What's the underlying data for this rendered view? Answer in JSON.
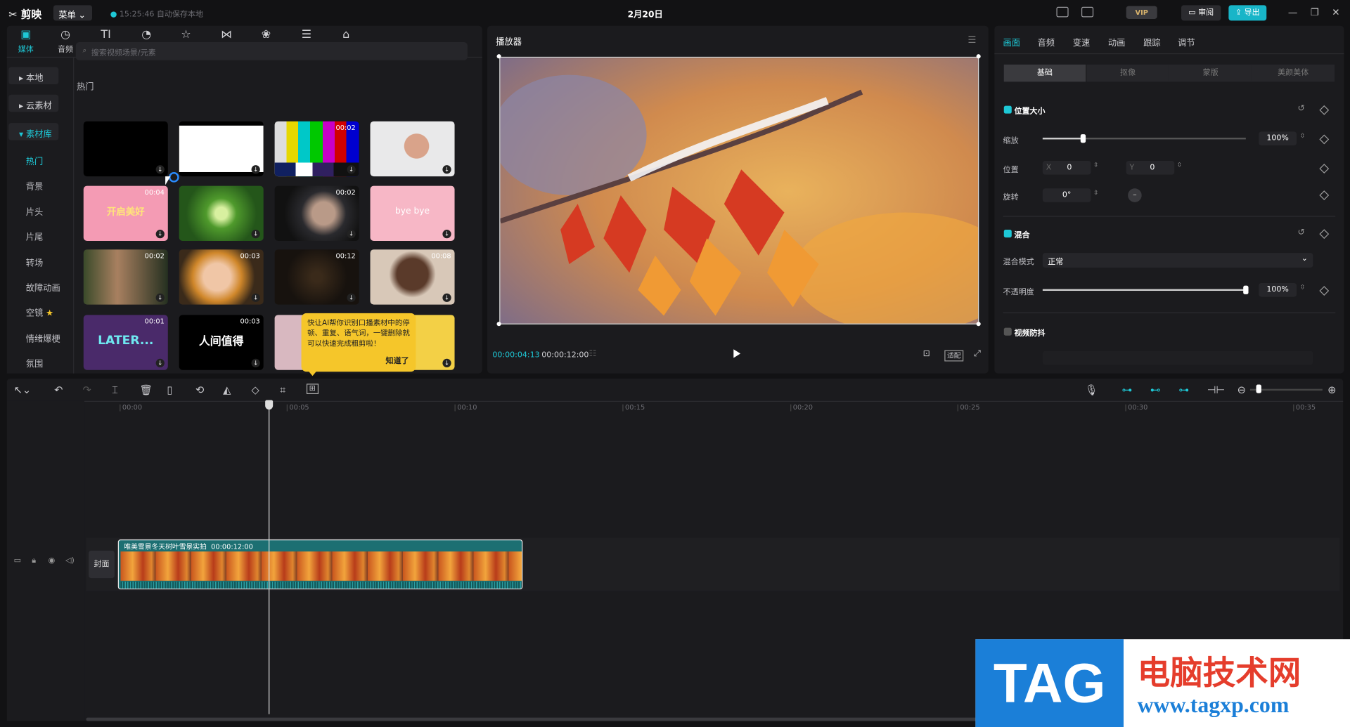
{
  "titlebar": {
    "app_name": "剪映",
    "menu_label": "菜单",
    "save_status": "15:25:46 自动保存本地",
    "project_date": "2月20日",
    "vip_label": "VIP",
    "review_label": "审阅",
    "export_label": "导出"
  },
  "media": {
    "tabs": [
      {
        "label": "媒体",
        "icon": "media-icon"
      },
      {
        "label": "音频",
        "icon": "audio-icon"
      },
      {
        "label": "文本",
        "icon": "text-icon"
      },
      {
        "label": "贴纸",
        "icon": "sticker-icon"
      },
      {
        "label": "特效",
        "icon": "effects-icon"
      },
      {
        "label": "转场",
        "icon": "transition-icon"
      },
      {
        "label": "滤镜",
        "icon": "filter-icon"
      },
      {
        "label": "调节",
        "icon": "adjust-icon"
      },
      {
        "label": "模板",
        "icon": "template-icon"
      }
    ],
    "sidebar": [
      "本地",
      "云素材",
      "素材库"
    ],
    "subsidebar": [
      "热门",
      "背景",
      "片头",
      "片尾",
      "转场",
      "故障动画",
      "空镜",
      "情绪爆梗",
      "氛围"
    ],
    "search_placeholder": "搜索视频场景/元素",
    "section_title": "热门",
    "thumbs": [
      {
        "duration": ""
      },
      {
        "duration": ""
      },
      {
        "duration": "00:02"
      },
      {
        "duration": ""
      },
      {
        "duration": "00:04",
        "text": "开启美好"
      },
      {
        "duration": ""
      },
      {
        "duration": "00:02"
      },
      {
        "duration": "",
        "text": "bye bye"
      },
      {
        "duration": "00:02"
      },
      {
        "duration": "00:03"
      },
      {
        "duration": "00:12"
      },
      {
        "duration": "00:08"
      },
      {
        "duration": "00:01",
        "text": "LATER..."
      },
      {
        "duration": "00:03",
        "text": "人间值得"
      },
      {
        "duration": ""
      },
      {
        "duration": ""
      }
    ],
    "tooltip_text": "快让AI帮你识别口播素材中的停顿、重复、语气词，一键删除就可以快速完成粗剪啦！",
    "tooltip_action": "知道了"
  },
  "player": {
    "title": "播放器",
    "current_time": "00:00:04:13",
    "total_time": "00:00:12:00",
    "ratio_label": "适配"
  },
  "properties": {
    "tabs": [
      "画面",
      "音频",
      "变速",
      "动画",
      "跟踪",
      "调节"
    ],
    "subtabs": [
      "基础",
      "抠像",
      "蒙版",
      "美颜美体"
    ],
    "position_size_title": "位置大小",
    "scale_label": "缩放",
    "scale_value": "100%",
    "scale_fraction": 0.2,
    "position_label": "位置",
    "x_label": "X",
    "x_value": "0",
    "y_label": "Y",
    "y_value": "0",
    "rotation_label": "旋转",
    "rotation_value": "0°",
    "blend_title": "混合",
    "blend_mode_label": "混合模式",
    "blend_mode_value": "正常",
    "opacity_label": "不透明度",
    "opacity_value": "100%",
    "opacity_fraction": 1.0,
    "stabilize_title": "视频防抖"
  },
  "timeline": {
    "ruler": [
      "00:00",
      "00:05",
      "00:10",
      "00:15",
      "00:20",
      "00:25",
      "00:30",
      "00:35"
    ],
    "cover_label": "封面",
    "clip_name": "唯美雪景冬天树叶雪景实拍",
    "clip_duration": "00:00:12:00"
  },
  "watermark": {
    "tag": "TAG",
    "cn": "电脑技术网",
    "url": "www.tagxp.com"
  },
  "colors": {
    "accent": "#1ec8d6",
    "export_button": "#18b5c8",
    "tooltip": "#f5c62a"
  }
}
